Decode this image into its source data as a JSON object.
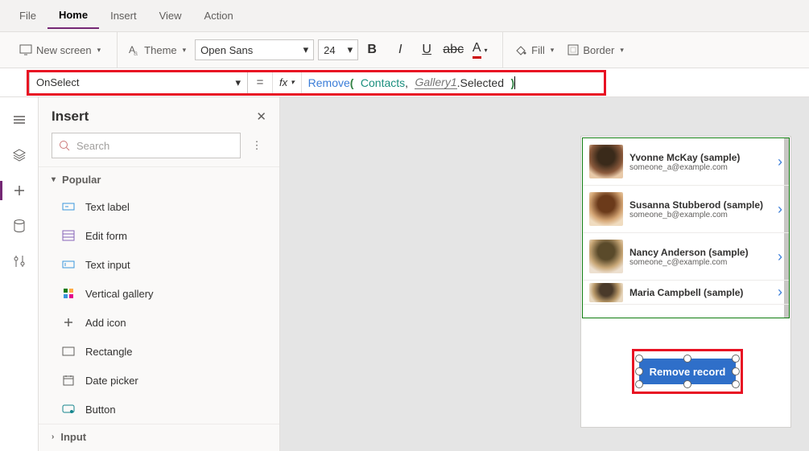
{
  "menu": {
    "file": "File",
    "home": "Home",
    "insert": "Insert",
    "view": "View",
    "action": "Action"
  },
  "ribbon": {
    "new_screen": "New screen",
    "theme": "Theme",
    "font_name": "Open Sans",
    "font_size": "24",
    "fill": "Fill",
    "border": "Border"
  },
  "formula": {
    "property": "OnSelect",
    "fn": "Remove",
    "arg1": "Contacts",
    "arg2": "Gallery1",
    "arg2prop": ".Selected"
  },
  "panel": {
    "title": "Insert",
    "search_placeholder": "Search",
    "section_popular": "Popular",
    "items": {
      "text_label": "Text label",
      "edit_form": "Edit form",
      "text_input": "Text input",
      "vertical_gallery": "Vertical gallery",
      "add_icon": "Add icon",
      "rectangle": "Rectangle",
      "date_picker": "Date picker",
      "button": "Button"
    },
    "section_input": "Input"
  },
  "gallery": {
    "rows": [
      {
        "name": "Yvonne McKay (sample)",
        "email": "someone_a@example.com"
      },
      {
        "name": "Susanna Stubberod (sample)",
        "email": "someone_b@example.com"
      },
      {
        "name": "Nancy Anderson (sample)",
        "email": "someone_c@example.com"
      },
      {
        "name": "Maria Campbell (sample)",
        "email": ""
      }
    ]
  },
  "button_label": "Remove record"
}
